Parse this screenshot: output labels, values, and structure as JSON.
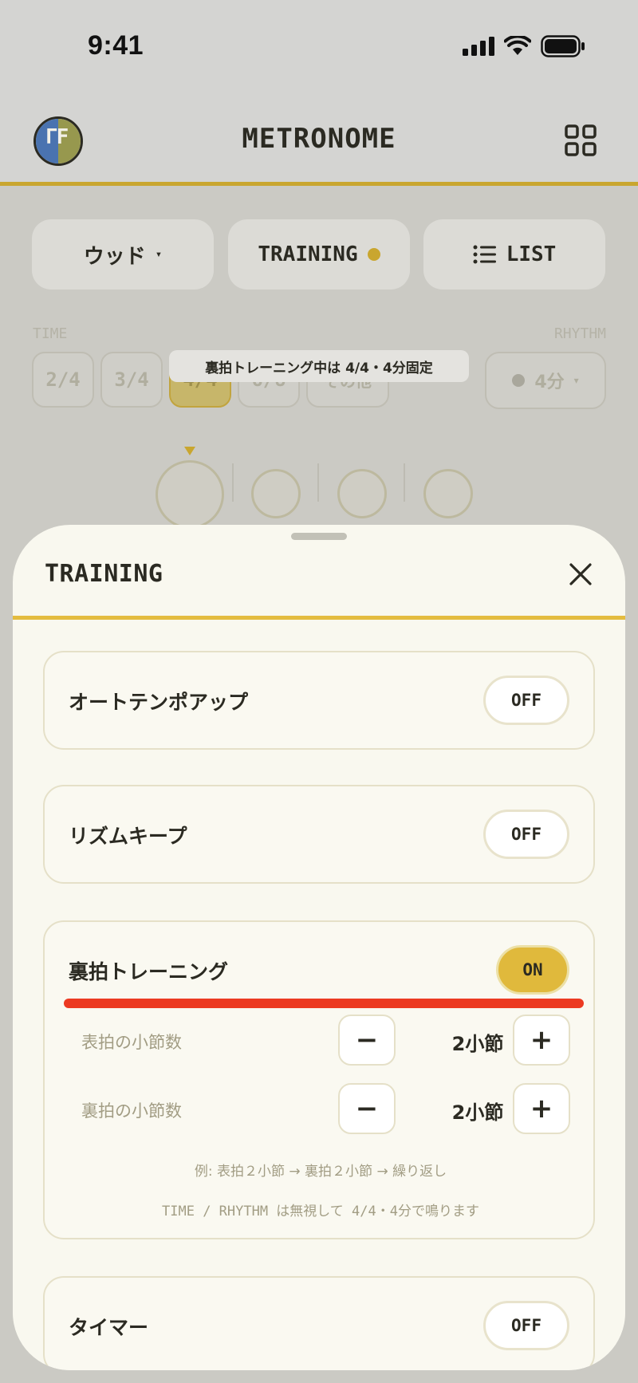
{
  "status_bar": {
    "time": "9:41"
  },
  "header": {
    "title": "METRONOME"
  },
  "controls": {
    "sound_label": "ウッド",
    "sound_caret": "▾",
    "training_label": "TRAINING",
    "list_label": "LIST"
  },
  "time_section": {
    "label": "TIME",
    "options": [
      "2/4",
      "3/4",
      "4/4",
      "6/8",
      "その他"
    ],
    "selected": "4/4"
  },
  "rhythm_section": {
    "label": "RHYTHM",
    "value": "4分",
    "caret": "▾"
  },
  "tooltip": "裏拍トレーニング中は 4/4・4分固定",
  "beats": {
    "count": 4,
    "current": 1
  },
  "sheet": {
    "title": "TRAINING",
    "auto_tempo": {
      "label": "オートテンポアップ",
      "state": "OFF"
    },
    "rhythm_keep": {
      "label": "リズムキープ",
      "state": "OFF"
    },
    "offbeat": {
      "label": "裏拍トレーニング",
      "state": "ON",
      "front_bars": {
        "label": "表拍の小節数",
        "value": "2小節",
        "minus": "−",
        "plus": "+"
      },
      "back_bars": {
        "label": "裏拍の小節数",
        "value": "2小節",
        "minus": "−",
        "plus": "+"
      },
      "example": "例: 表拍２小節 → 裏拍２小節 → 繰り返し",
      "note": "TIME / RHYTHM は無視して 4/4・4分で鳴ります"
    },
    "timer": {
      "label": "タイマー",
      "state": "OFF"
    }
  },
  "colors": {
    "accent": "#c9a62f",
    "highlight_red": "#ec3a22",
    "sheet_bg": "#f9f8ef"
  }
}
